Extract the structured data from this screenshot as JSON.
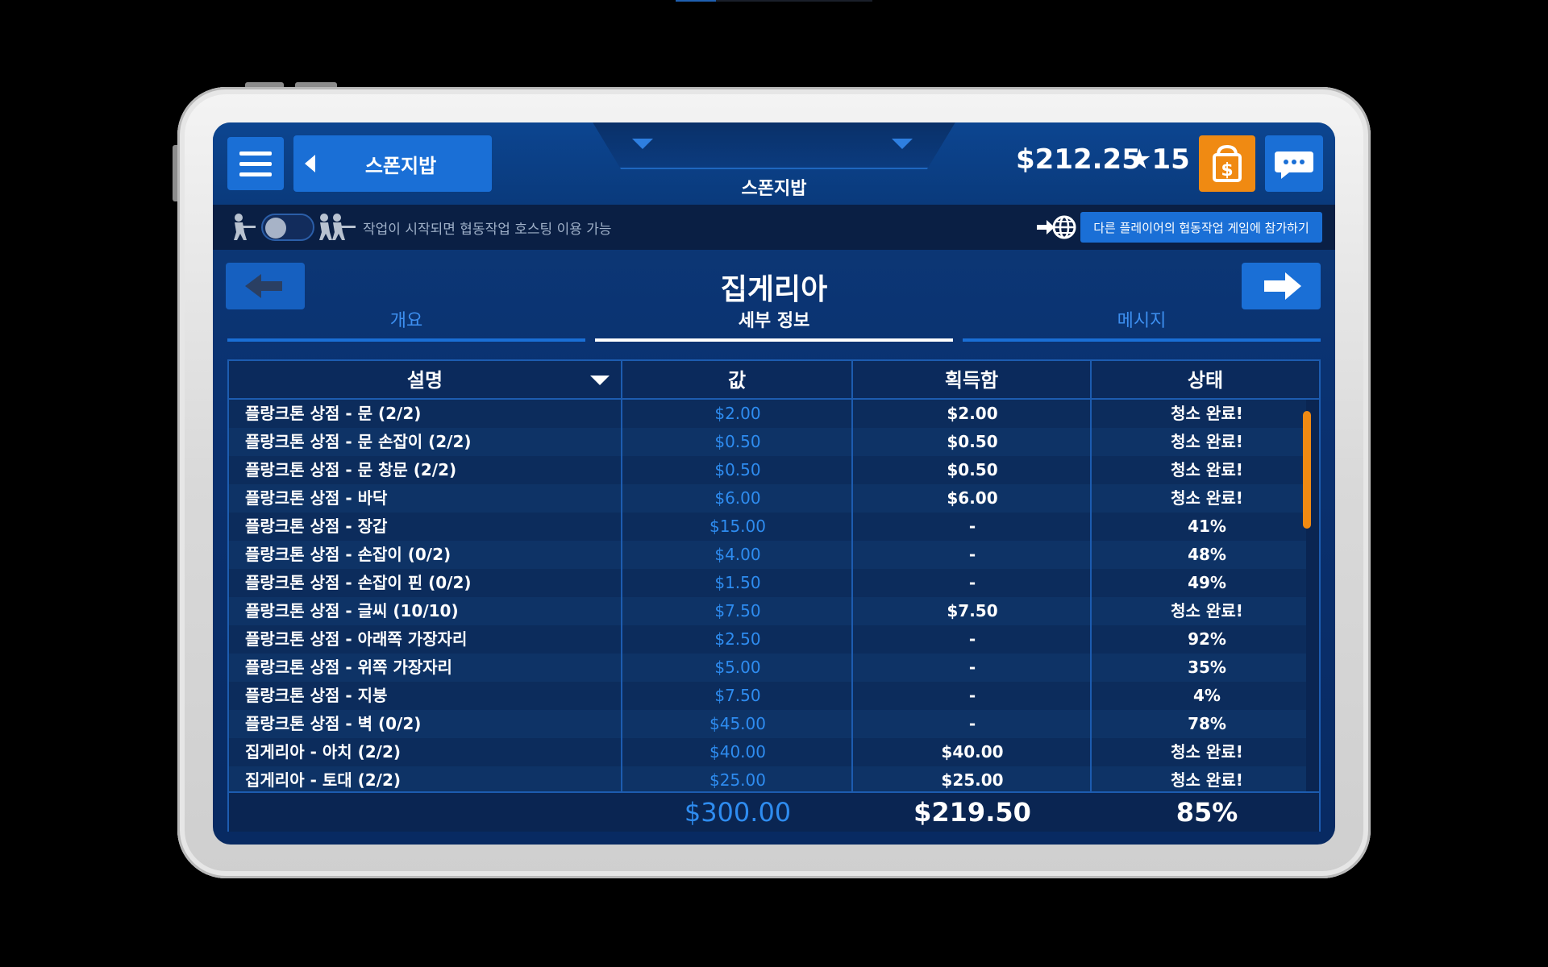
{
  "header": {
    "location_label": "스폰지밥",
    "center_title": "스폰지밥",
    "money": "$212.25",
    "stars": "★15"
  },
  "coop": {
    "info_text": "작업이 시작되면 협동작업 호스팅 이용 가능",
    "join_label": "다른 플레이어의 협동작업 게임에 참가하기"
  },
  "section": {
    "title": "집게리아",
    "tabs": [
      "개요",
      "세부 정보",
      "메시지"
    ]
  },
  "table": {
    "headers": [
      "설명",
      "값",
      "획득함",
      "상태"
    ],
    "rows": [
      {
        "desc": "플랑크톤 상점 - 문 (2/2)",
        "value": "$2.00",
        "earned": "$2.00",
        "status": "청소 완료!"
      },
      {
        "desc": "플랑크톤 상점 - 문 손잡이 (2/2)",
        "value": "$0.50",
        "earned": "$0.50",
        "status": "청소 완료!"
      },
      {
        "desc": "플랑크톤 상점 - 문 창문 (2/2)",
        "value": "$0.50",
        "earned": "$0.50",
        "status": "청소 완료!"
      },
      {
        "desc": "플랑크톤 상점 - 바닥",
        "value": "$6.00",
        "earned": "$6.00",
        "status": "청소 완료!"
      },
      {
        "desc": "플랑크톤 상점 - 장갑",
        "value": "$15.00",
        "earned": "-",
        "status": "41%"
      },
      {
        "desc": "플랑크톤 상점 - 손잡이 (0/2)",
        "value": "$4.00",
        "earned": "-",
        "status": "48%"
      },
      {
        "desc": "플랑크톤 상점 - 손잡이 핀 (0/2)",
        "value": "$1.50",
        "earned": "-",
        "status": "49%"
      },
      {
        "desc": "플랑크톤 상점 - 글씨 (10/10)",
        "value": "$7.50",
        "earned": "$7.50",
        "status": "청소 완료!"
      },
      {
        "desc": "플랑크톤 상점 - 아래쪽 가장자리",
        "value": "$2.50",
        "earned": "-",
        "status": "92%"
      },
      {
        "desc": "플랑크톤 상점 - 위쪽 가장자리",
        "value": "$5.00",
        "earned": "-",
        "status": "35%"
      },
      {
        "desc": "플랑크톤 상점 - 지붕",
        "value": "$7.50",
        "earned": "-",
        "status": "4%"
      },
      {
        "desc": "플랑크톤 상점 - 벽 (0/2)",
        "value": "$45.00",
        "earned": "-",
        "status": "78%"
      },
      {
        "desc": "집게리아 - 아치 (2/2)",
        "value": "$40.00",
        "earned": "$40.00",
        "status": "청소 완료!"
      },
      {
        "desc": "집게리아 - 토대 (2/2)",
        "value": "$25.00",
        "earned": "$25.00",
        "status": "청소 완료!"
      }
    ],
    "totals": {
      "value": "$300.00",
      "earned": "$219.50",
      "status": "85%"
    }
  },
  "colors": {
    "accent_blue": "#1a6fd6",
    "value_blue": "#2e8cf0",
    "shop_orange": "#f08a12",
    "scrollbar": "#f08a12"
  },
  "icons": [
    "menu-icon",
    "back-triangle-icon",
    "shop-bag-icon",
    "chat-icon",
    "worker-icon",
    "worker-group-icon",
    "join-globe-icon",
    "arrow-left-icon",
    "arrow-right-icon",
    "sort-triangle-icon"
  ]
}
